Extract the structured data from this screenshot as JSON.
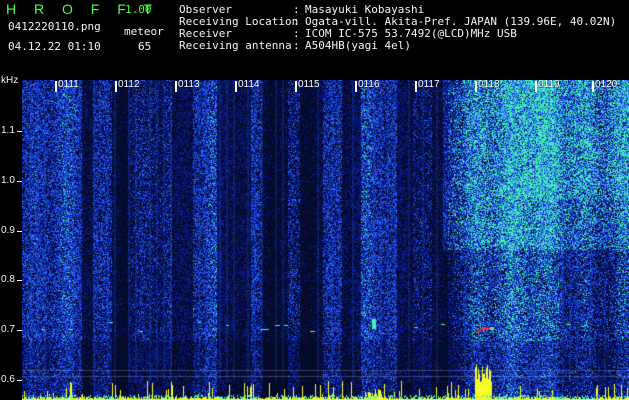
{
  "header": {
    "app_title": "H R O F F T",
    "app_version": "1.00",
    "file_name": "0412220110.png",
    "meteor_label": "meteor",
    "capture_time": "04.12.22 01:10",
    "meteor_count": "65"
  },
  "info": [
    {
      "label": "Observer",
      "colon": ":",
      "value": "Masayuki Kobayashi"
    },
    {
      "label": "Receiving Location",
      "colon": ":",
      "value": "Ogata-vill. Akita-Pref. JAPAN (139.96E, 40.02N)"
    },
    {
      "label": "Receiver",
      "colon": ":",
      "value": "ICOM IC-575 53.7492(@LCD)MHz USB"
    },
    {
      "label": "Receiving antenna",
      "colon": ":",
      "value": "A504HB(yagi 4el)"
    }
  ],
  "axis": {
    "unit": "kHz",
    "y_ticks": [
      {
        "label": "1.1",
        "value": 1.1
      },
      {
        "label": "1.0",
        "value": 1.0
      },
      {
        "label": "0.9",
        "value": 0.9
      },
      {
        "label": "0.8",
        "value": 0.8
      },
      {
        "label": "0.7",
        "value": 0.7
      },
      {
        "label": "0.6",
        "value": 0.6
      }
    ],
    "time_labels": [
      "0111",
      "0112",
      "0113",
      "0114",
      "0115",
      "0116",
      "0117",
      "0118",
      "0119",
      "0120"
    ]
  },
  "spectrogram": {
    "background_color": "#040a2a",
    "low_color": "#0a1d96",
    "mid_color": "#2b63ff",
    "high_color": "#45f0b4",
    "hot_color": "#f7ff28",
    "meteor_color": "#ff2e2e"
  }
}
